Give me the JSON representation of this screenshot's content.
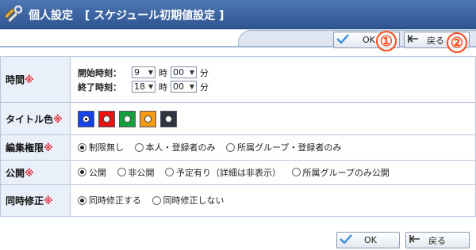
{
  "header": {
    "title": "個人設定",
    "subtitle": "[ スケジュール初期値設定 ]",
    "icon": "tools-icon"
  },
  "toolbar_top": {
    "ok_label": "OK",
    "back_label": "戻る",
    "ok_icon": "checkmark-icon",
    "back_icon": "back-arrow-icon"
  },
  "annotations": [
    "①",
    "②"
  ],
  "required_mark": "※",
  "form": {
    "time": {
      "label": "時間",
      "start_label": "開始時刻：",
      "end_label": "終了時刻：",
      "start_hour": "9",
      "start_minute": "00",
      "end_hour": "18",
      "end_minute": "00",
      "hour_unit": "時",
      "minute_unit": "分"
    },
    "title_color": {
      "label": "タイトル色",
      "swatches": [
        {
          "color": "#1444e8",
          "selected": true
        },
        {
          "color": "#e81414",
          "selected": false
        },
        {
          "color": "#14a03c",
          "selected": false
        },
        {
          "color": "#f59a14",
          "selected": false
        },
        {
          "color": "#2e3440",
          "selected": false
        }
      ]
    },
    "edit_permission": {
      "label": "編集権限",
      "options": [
        "制限無し",
        "本人・登録者のみ",
        "所属グループ・登録者のみ"
      ],
      "selected": 0
    },
    "visibility": {
      "label": "公開",
      "options": [
        "公開",
        "非公開",
        "予定有り（詳細は非表示）",
        "所属グループのみ公開"
      ],
      "selected": 0
    },
    "simultaneous_edit": {
      "label": "同時修正",
      "options": [
        "同時修正する",
        "同時修正しない"
      ],
      "selected": 0
    }
  },
  "toolbar_bottom": {
    "ok_label": "OK",
    "back_label": "戻る"
  },
  "colors": {
    "header_bg": "#3a62a0",
    "label_bg": "#eaf0f9",
    "required": "#e0303a",
    "annotation": "#ff4b1f"
  }
}
